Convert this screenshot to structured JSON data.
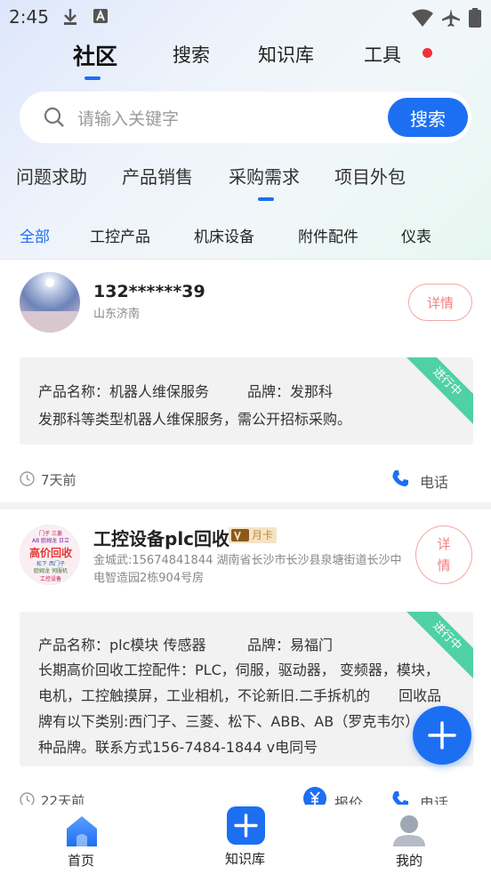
{
  "status_bar": {
    "time": "2:45"
  },
  "header": {
    "tabs": [
      {
        "label": "社区",
        "active": true
      },
      {
        "label": "搜索",
        "active": false
      },
      {
        "label": "知识库",
        "active": false
      },
      {
        "label": "工具",
        "active": false
      }
    ]
  },
  "search": {
    "placeholder": "请输入关键字",
    "button_label": "搜索"
  },
  "category_tabs": [
    {
      "label": "问题求助",
      "active": false
    },
    {
      "label": "产品销售",
      "active": false
    },
    {
      "label": "采购需求",
      "active": true
    },
    {
      "label": "项目外包",
      "active": false
    }
  ],
  "sub_tabs": [
    {
      "label": "全部",
      "active": true
    },
    {
      "label": "工控产品",
      "active": false
    },
    {
      "label": "机床设备",
      "active": false
    },
    {
      "label": "附件配件",
      "active": false
    },
    {
      "label": "仪表",
      "active": false
    }
  ],
  "posts": [
    {
      "user_name": "132******39",
      "location": "山东济南",
      "detail_label": "详情",
      "product_label": "产品名称：机器人维保服务",
      "brand_label": "品牌：发那科",
      "description": "发那科等类型机器人维保服务，需公开招标采购。",
      "status_ribbon": "进行中",
      "time": "7天前",
      "phone_label": "电话"
    },
    {
      "user_name": "工控设备plc回收",
      "badge": "月卡",
      "location": "金城武:15674841844 湖南省长沙市长沙县泉塘街道长沙中电智造园2栋904号房",
      "detail_label": "详情",
      "product_label": "产品名称：plc模块 传感器",
      "brand_label": "品牌：易福门",
      "description": "长期高价回收工控配件：PLC，伺服，驱动器， 变频器，模块，电机，工控触摸屏，工业相机，不论新旧.二手拆机的　　回收品牌有以下类别:西门子、三菱、松下、ABB、AB（罗克韦尔）等各种品牌。联系方式156-7484-1844 v电同号",
      "status_ribbon": "进行中",
      "time": "22天前",
      "quote_label": "报价",
      "phone_label": "电话",
      "avatar_text": {
        "line1": "门子 三菱",
        "line2": "AB 欧姆龙 日立",
        "main": "高价回收",
        "line3": "松下 西门子",
        "line4": "欧姆龙 伺服机",
        "line5": "工控设备"
      }
    }
  ],
  "bottom_nav": [
    {
      "label": "首页",
      "icon": "home-icon"
    },
    {
      "label": "知识库",
      "icon": "plus-icon"
    },
    {
      "label": "我的",
      "icon": "person-icon"
    }
  ],
  "colors": {
    "accent": "#1d6ff2",
    "ribbon": "#4fd1a5",
    "detail": "#f08080",
    "dot": "#f0313b"
  }
}
